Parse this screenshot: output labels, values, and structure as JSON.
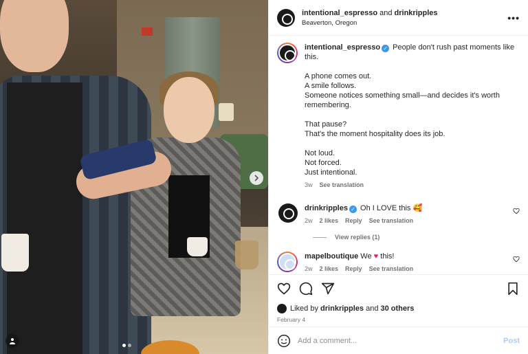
{
  "post": {
    "author": "intentional_espresso",
    "and_text": "and",
    "collaborator": "drinkripples",
    "location": "Beaverton, Oregon",
    "more_icon": "more-horizontal-icon"
  },
  "caption": {
    "author": "intentional_espresso",
    "lines": [
      "People don't rush past moments like this.",
      "A phone comes out.\nA smile follows.\nSomeone notices something small—and decides it's worth remembering.",
      "That pause?\nThat's the moment hospitality does its job.",
      "Not loud.\nNot forced.\nJust intentional."
    ],
    "time": "3w",
    "see_translation": "See translation"
  },
  "comments": [
    {
      "author": "drinkripples",
      "verified": true,
      "text": "Oh I LOVE this 🥰",
      "time": "2w",
      "likes": "2 likes",
      "reply": "Reply",
      "see_translation": "See translation",
      "view_replies": "View replies (1)"
    },
    {
      "author": "mapelboutique",
      "verified": false,
      "text_before": "We",
      "text_after": "this!",
      "time": "2w",
      "likes": "2 likes",
      "reply": "Reply",
      "see_translation": "See translation"
    }
  ],
  "liked_by": {
    "prefix": "Liked by",
    "user": "drinkripples",
    "and": "and",
    "others": "30 others"
  },
  "date": "February 4",
  "composer": {
    "placeholder": "Add a comment...",
    "post_label": "Post"
  },
  "icons": [
    "heart-icon",
    "comment-icon",
    "share-icon",
    "bookmark-icon",
    "emoji-icon",
    "user-tag-icon",
    "chevron-right-icon"
  ],
  "colors": {
    "verified": "#3897f0",
    "post_button": "#a7cdfa",
    "heart_emoji": "#e0245e"
  }
}
